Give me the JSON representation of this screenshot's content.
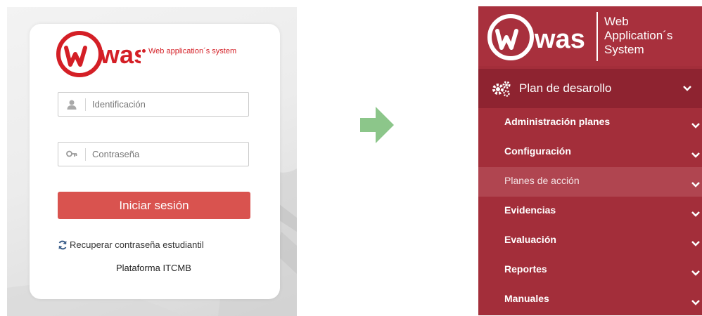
{
  "login": {
    "logo_text": "was",
    "tagline": "Web application´s system",
    "username_placeholder": "Identificación",
    "password_placeholder": "Contraseña",
    "submit_label": "Iniciar sesión",
    "recover_label": "Recuperar contraseña estudiantil",
    "platform_label": "Plataforma ITCMB"
  },
  "menu": {
    "logo_text": "was",
    "brand_lines": [
      "Web",
      "Application´s",
      "System"
    ],
    "section_label": "Plan de desarollo",
    "items": [
      {
        "label": "Administración planes",
        "active": false
      },
      {
        "label": "Configuración",
        "active": false
      },
      {
        "label": "Planes de acción",
        "active": true
      },
      {
        "label": "Evidencias",
        "active": false
      },
      {
        "label": "Evaluación",
        "active": false
      },
      {
        "label": "Reportes",
        "active": false
      },
      {
        "label": "Manuales",
        "active": false
      }
    ]
  },
  "colors": {
    "brand_red": "#d41f26",
    "button_red": "#d9534f",
    "menu_bg": "#a32e3a",
    "menu_section_bg": "#8e2330",
    "menu_active_bg": "#b04550",
    "arrow_green": "#8cc68a"
  },
  "icons": {
    "username": "user-icon",
    "password": "key-icon",
    "recover": "refresh-icon",
    "section": "gears-icon",
    "expand": "chevron-down-icon",
    "transition": "arrow-right-icon"
  }
}
